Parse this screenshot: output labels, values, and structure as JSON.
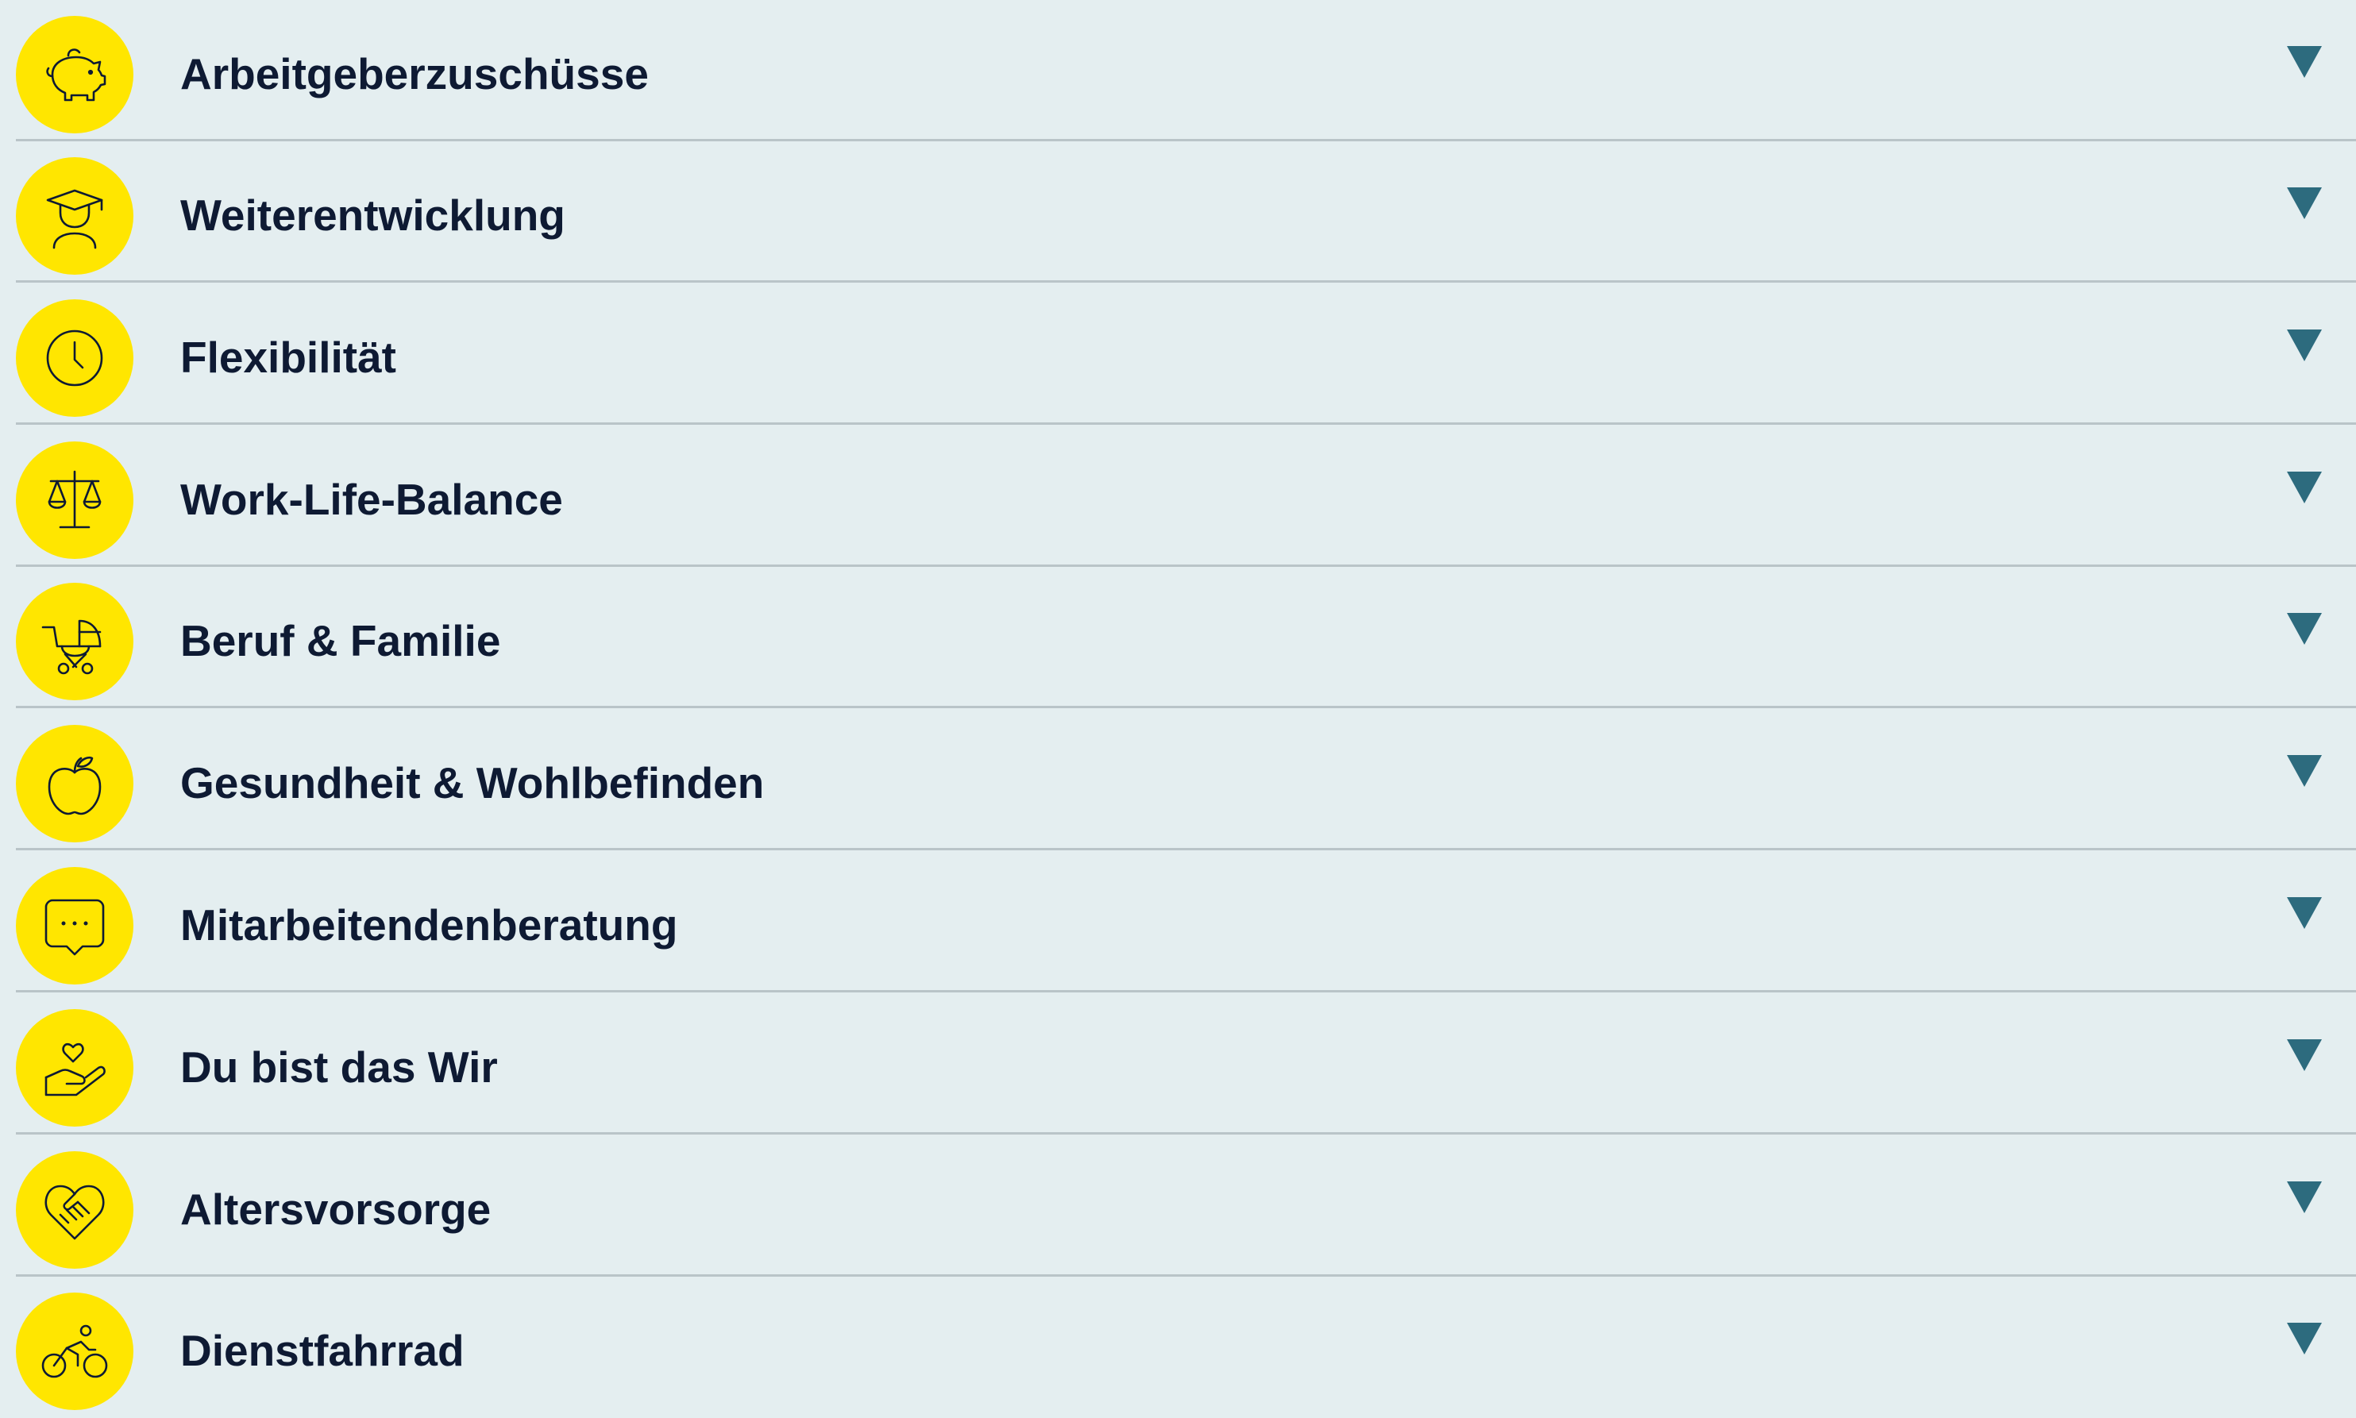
{
  "colors": {
    "background": "#e4eef0",
    "icon_badge": "#ffe600",
    "text": "#0e1a33",
    "chevron": "#2d6b7e",
    "divider": "#b9c4c8"
  },
  "items": [
    {
      "label": "Arbeitgeberzuschüsse",
      "icon": "piggy-bank-icon",
      "expanded": false
    },
    {
      "label": "Weiterentwicklung",
      "icon": "graduate-icon",
      "expanded": false
    },
    {
      "label": "Flexibilität",
      "icon": "clock-icon",
      "expanded": false
    },
    {
      "label": "Work-Life-Balance",
      "icon": "scales-icon",
      "expanded": false
    },
    {
      "label": "Beruf & Familie",
      "icon": "stroller-icon",
      "expanded": false
    },
    {
      "label": "Gesundheit & Wohlbefinden",
      "icon": "apple-icon",
      "expanded": false
    },
    {
      "label": "Mitarbeitendenberatung",
      "icon": "chat-bubble-icon",
      "expanded": false
    },
    {
      "label": "Du bist das Wir",
      "icon": "hand-heart-icon",
      "expanded": false
    },
    {
      "label": "Altersvorsorge",
      "icon": "handshake-heart-icon",
      "expanded": false
    },
    {
      "label": "Dienstfahrrad",
      "icon": "bicycle-icon",
      "expanded": false
    }
  ],
  "chevron_icon": "triangle-down-icon"
}
